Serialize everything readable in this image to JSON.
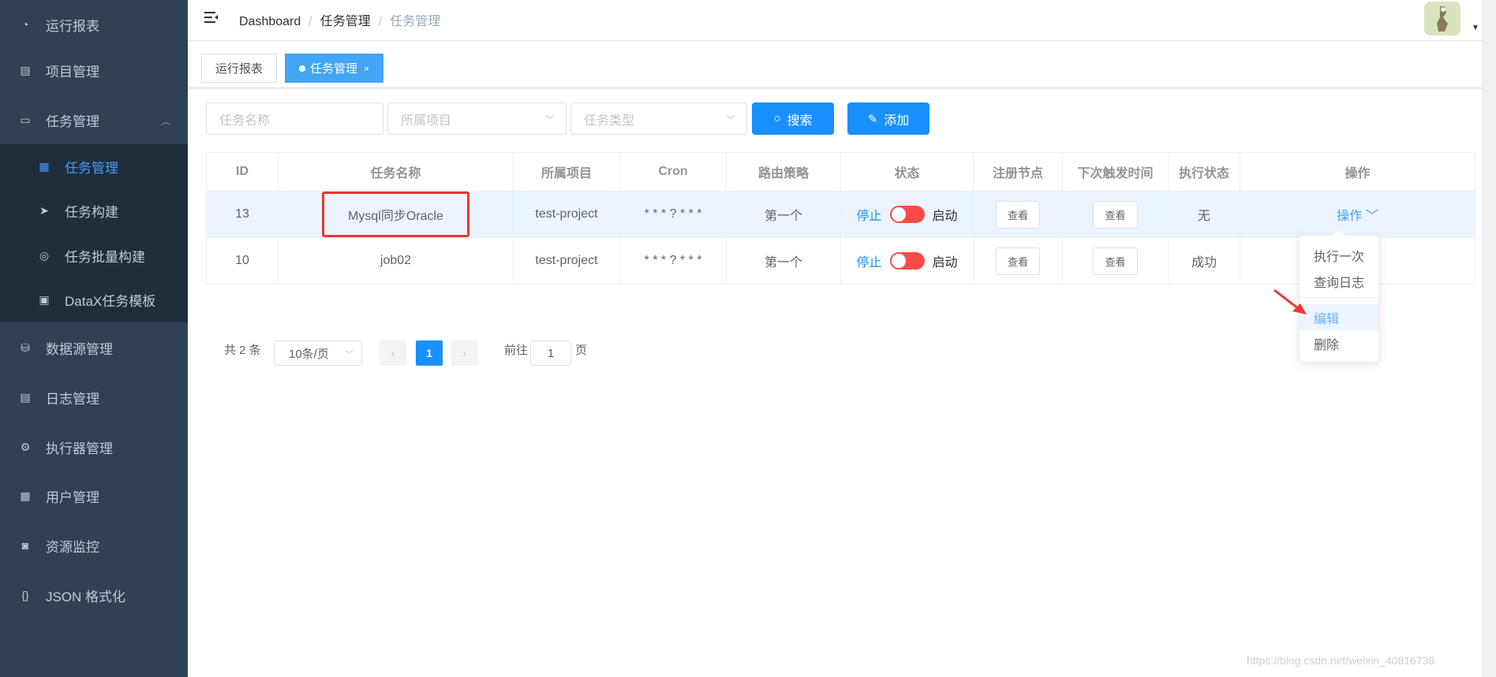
{
  "sidebar": {
    "items": [
      {
        "label": "运行报表",
        "icon": "dashboard-icon"
      },
      {
        "label": "项目管理",
        "icon": "project-icon"
      },
      {
        "label": "任务管理",
        "icon": "monitor-icon"
      },
      {
        "label": "数据源管理",
        "icon": "database-icon"
      },
      {
        "label": "日志管理",
        "icon": "log-icon"
      },
      {
        "label": "执行器管理",
        "icon": "executor-icon"
      },
      {
        "label": "用户管理",
        "icon": "user-table-icon"
      },
      {
        "label": "资源监控",
        "icon": "monitor-resource-icon"
      },
      {
        "label": "JSON 格式化",
        "icon": "json-icon"
      }
    ],
    "subitems": [
      {
        "label": "任务管理",
        "icon": "calendar-icon",
        "active": true
      },
      {
        "label": "任务构建",
        "icon": "send-icon"
      },
      {
        "label": "任务批量构建",
        "icon": "batch-icon"
      },
      {
        "label": "DataX任务模板",
        "icon": "template-icon"
      }
    ]
  },
  "navbar": {
    "breadcrumb": [
      "Dashboard",
      "任务管理",
      "任务管理"
    ],
    "separator": "/"
  },
  "tags": [
    {
      "label": "运行报表"
    },
    {
      "label": "任务管理",
      "close": "×"
    }
  ],
  "filters": {
    "task_name_placeholder": "任务名称",
    "project_placeholder": "所属项目",
    "type_placeholder": "任务类型",
    "search_label": "搜索",
    "add_label": "添加"
  },
  "table": {
    "headers": [
      "ID",
      "任务名称",
      "所属项目",
      "Cron",
      "路由策略",
      "状态",
      "注册节点",
      "下次触发时间",
      "执行状态",
      "操作"
    ],
    "rows": [
      {
        "id": "13",
        "name": "Mysql同步Oracle",
        "project": "test-project",
        "cron": "* * * ? * * *",
        "route": "第一个",
        "stop": "停止",
        "start": "启动",
        "node": "查看",
        "next": "查看",
        "exec": "无",
        "op": "操作"
      },
      {
        "id": "10",
        "name": "job02",
        "project": "test-project",
        "cron": "* * * ? * * *",
        "route": "第一个",
        "stop": "停止",
        "start": "启动",
        "node": "查看",
        "next": "查看",
        "exec": "成功",
        "op": ""
      }
    ]
  },
  "dropdown": {
    "items": [
      "执行一次",
      "查询日志",
      "编辑",
      "删除"
    ],
    "active_index": 2
  },
  "pagination": {
    "total": "共 2 条",
    "page_size": "10条/页",
    "current": "1",
    "goto_prefix": "前往",
    "goto_value": "1",
    "goto_suffix": "页"
  },
  "watermark": "https://blog.csdn.net/weixin_40816738",
  "colors": {
    "sidebar_bg": "#304156",
    "primary": "#1890ff",
    "highlight_border": "#e53935",
    "switch_red": "#ff4949"
  }
}
